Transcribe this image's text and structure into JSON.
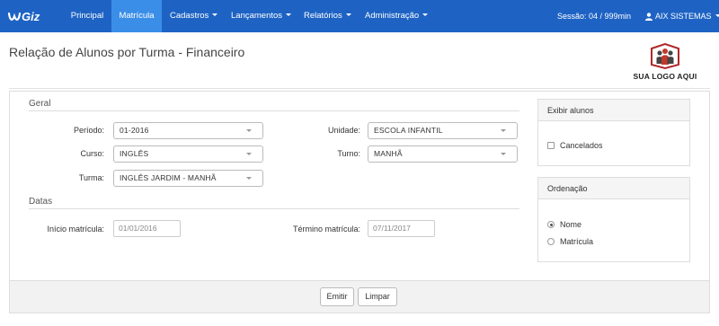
{
  "navbar": {
    "brand": "wGiz",
    "items": [
      {
        "label": "Principal",
        "active": false,
        "dropdown": false
      },
      {
        "label": "Matrícula",
        "active": true,
        "dropdown": false
      },
      {
        "label": "Cadastros",
        "active": false,
        "dropdown": true
      },
      {
        "label": "Lançamentos",
        "active": false,
        "dropdown": true
      },
      {
        "label": "Relatórios",
        "active": false,
        "dropdown": true
      },
      {
        "label": "Administração",
        "active": false,
        "dropdown": true
      }
    ],
    "session": "Sessão: 04 / 999min",
    "user": "AIX SISTEMAS",
    "colors": {
      "bar": "#1e63c4",
      "active": "#3a8ee8"
    }
  },
  "page": {
    "title": "Relação de Alunos por Turma - Financeiro",
    "logo_text": "SUA LOGO AQUI"
  },
  "form": {
    "general_section": "Geral",
    "periodo": {
      "label": "Período:",
      "value": "01-2016"
    },
    "curso": {
      "label": "Curso:",
      "value": "INGLÊS"
    },
    "turma": {
      "label": "Turma:",
      "value": "INGLÊS JARDIM - MANHÃ"
    },
    "unidade": {
      "label": "Unidade:",
      "value": "ESCOLA INFANTIL"
    },
    "turno": {
      "label": "Turno:",
      "value": "MANHÃ"
    },
    "dates_section": "Datas",
    "inicio": {
      "label": "Início matrícula:",
      "value": "01/01/2016"
    },
    "termino": {
      "label": "Término matrícula:",
      "value": "07/11/2017"
    }
  },
  "exibir": {
    "title": "Exibir alunos",
    "options": [
      {
        "label": "Cancelados",
        "checked": false
      }
    ]
  },
  "ordenacao": {
    "title": "Ordenação",
    "options": [
      {
        "label": "Nome",
        "selected": true
      },
      {
        "label": "Matrícula",
        "selected": false
      }
    ]
  },
  "buttons": {
    "emitir": "Emitir",
    "limpar": "Limpar"
  }
}
